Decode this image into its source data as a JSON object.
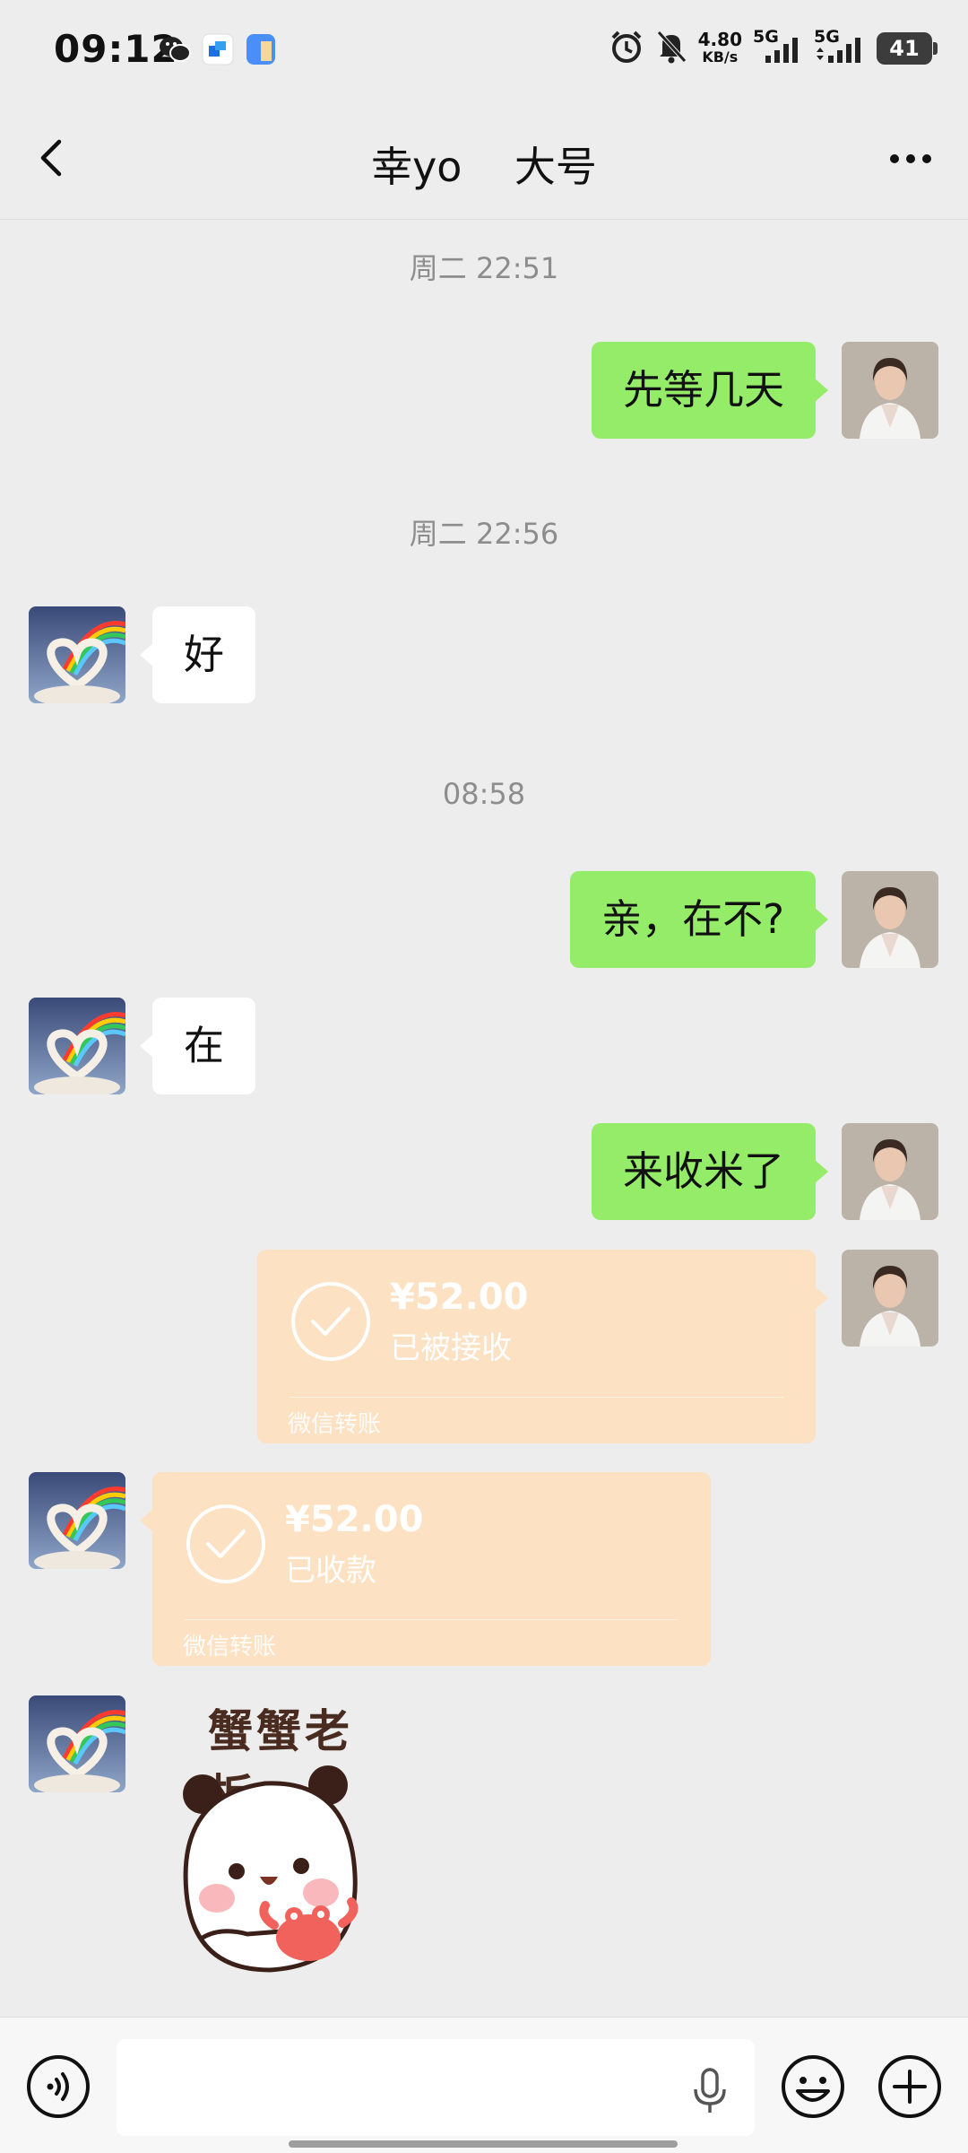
{
  "status_bar": {
    "time": "09:12",
    "net_speed_value": "4.80",
    "net_speed_unit": "KB/s",
    "signal1_label": "5G",
    "signal2_label": "5G",
    "battery": "41",
    "icons": [
      "wechat-icon",
      "app-icon",
      "files-icon",
      "alarm-icon",
      "mute-icon",
      "signal-icon",
      "battery-icon"
    ]
  },
  "header": {
    "title": "幸yo    大号"
  },
  "messages": {
    "ts1": "周二 22:51",
    "m1": "先等几天",
    "ts2": "周二 22:56",
    "m2": "好",
    "ts3": "08:58",
    "m3": "亲，在不?",
    "m4": "在",
    "m5": "来收米了",
    "transfer_sent": {
      "amount": "¥52.00",
      "status": "已被接收",
      "label": "微信转账"
    },
    "transfer_received": {
      "amount": "¥52.00",
      "status": "已收款",
      "label": "微信转账"
    },
    "sticker_text": "蟹蟹老板"
  },
  "colors": {
    "bubble_me": "#95ec69",
    "bubble_other": "#ffffff",
    "transfer": "#fde1c3",
    "background": "#ededed"
  },
  "input": {
    "value": "",
    "placeholder": ""
  }
}
